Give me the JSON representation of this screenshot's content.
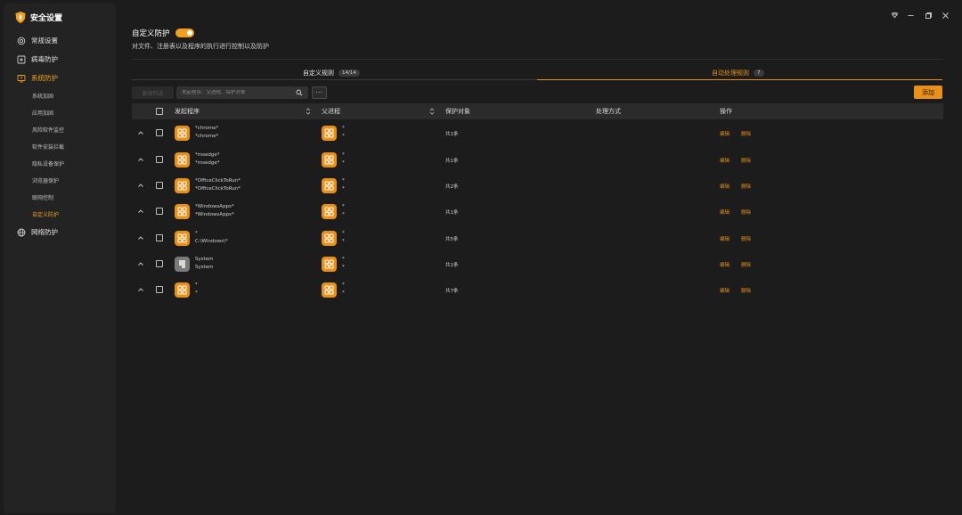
{
  "app": {
    "title": "安全设置",
    "accent": "#f0a020"
  },
  "sidebar": {
    "top_items": [
      {
        "label": "常规设置",
        "icon": "gear-icon"
      },
      {
        "label": "病毒防护",
        "icon": "plus-square-icon"
      },
      {
        "label": "系统防护",
        "icon": "monitor-icon",
        "active": true
      },
      {
        "label": "网络防护",
        "icon": "globe-icon"
      }
    ],
    "sub_items": [
      {
        "label": "系统加固"
      },
      {
        "label": "应用加固"
      },
      {
        "label": "风险软件监控"
      },
      {
        "label": "软件安装拦截"
      },
      {
        "label": "隐私设备保护"
      },
      {
        "label": "浏览器保护"
      },
      {
        "label": "联网控制"
      },
      {
        "label": "自定义防护",
        "active": true
      }
    ]
  },
  "window_controls": [
    "dropdown-icon",
    "minimize-icon",
    "restore-icon",
    "close-icon"
  ],
  "header": {
    "title": "自定义防护",
    "toggle_on": true,
    "description": "对文件、注册表以及程序的执行进行控制以及防护"
  },
  "tabs": [
    {
      "label": "自定义规则",
      "count": "14/14",
      "active": false
    },
    {
      "label": "自动处理规则",
      "count": "7",
      "active": true
    }
  ],
  "toolbar": {
    "deselect_label": "撤销所选",
    "search_placeholder": "发起程序、父进程、保护对象",
    "more_label": "···",
    "add_label": "添加"
  },
  "table": {
    "columns": [
      "发起程序",
      "父进程",
      "保护对象",
      "处理方式",
      "操作"
    ],
    "rows": [
      {
        "launcher": [
          "*chrome*",
          "*chrome*"
        ],
        "launcher_icon": "app",
        "parent": [
          "*",
          "*"
        ],
        "target": "共1条",
        "edit": "编辑",
        "delete": "删除"
      },
      {
        "launcher": [
          "*msedge*",
          "*msedge*"
        ],
        "launcher_icon": "app",
        "parent": [
          "*",
          "*"
        ],
        "target": "共1条",
        "edit": "编辑",
        "delete": "删除"
      },
      {
        "launcher": [
          "*OfficeClickToRun*",
          "*OfficeClickToRun*"
        ],
        "launcher_icon": "app",
        "parent": [
          "*",
          "*"
        ],
        "target": "共2条",
        "edit": "编辑",
        "delete": "删除"
      },
      {
        "launcher": [
          "*WindowsApps*",
          "*WindowsApps*"
        ],
        "launcher_icon": "app",
        "parent": [
          "*",
          "*"
        ],
        "target": "共1条",
        "edit": "编辑",
        "delete": "删除"
      },
      {
        "launcher": [
          "*",
          "C:\\Windows\\*"
        ],
        "launcher_icon": "app",
        "parent": [
          "*",
          "*"
        ],
        "target": "共5条",
        "edit": "编辑",
        "delete": "删除"
      },
      {
        "launcher": [
          "System",
          "System"
        ],
        "launcher_icon": "system",
        "parent": [
          "*",
          "*"
        ],
        "target": "共1条",
        "edit": "编辑",
        "delete": "删除"
      },
      {
        "launcher": [
          "*",
          "*"
        ],
        "launcher_icon": "app",
        "parent": [
          "*",
          "*"
        ],
        "target": "共7条",
        "edit": "编辑",
        "delete": "删除"
      }
    ]
  }
}
